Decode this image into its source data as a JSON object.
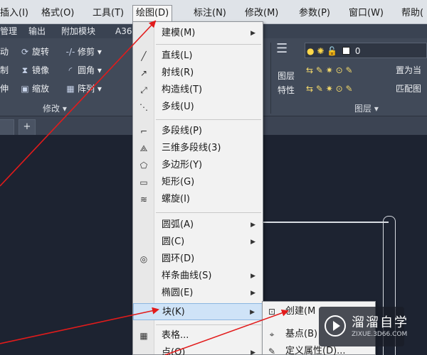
{
  "menubar": {
    "items": [
      "插入(I)",
      "格式(O)",
      "工具(T)",
      "绘图(D)",
      "标注(N)",
      "修改(M)",
      "参数(P)",
      "窗口(W)",
      "帮助("
    ]
  },
  "ribbon_tabs": [
    "管理",
    "输出",
    "附加模块",
    "A36"
  ],
  "ribbon": {
    "modify": {
      "rows": [
        [
          "动",
          "旋转",
          "修剪"
        ],
        [
          "制",
          "镜像",
          "圆角"
        ],
        [
          "伸",
          "缩放",
          "阵列"
        ]
      ],
      "title": "修改 ▾"
    },
    "layers": {
      "big_button_label_1": "图层",
      "big_button_label_2": "特性",
      "current_layer": "0",
      "set_current": "置为当",
      "match": "匹配图",
      "title": "图层 ▾"
    }
  },
  "file_tabs": {
    "add": "+"
  },
  "draw_menu": {
    "items": [
      {
        "label": "建模(M)",
        "sub": true,
        "icon": "none"
      },
      {
        "label": "直线(L)",
        "sub": false,
        "icon": "line-icon"
      },
      {
        "label": "射线(R)",
        "sub": false,
        "icon": "ray-icon"
      },
      {
        "label": "构造线(T)",
        "sub": false,
        "icon": "xline-icon"
      },
      {
        "label": "多线(U)",
        "sub": false,
        "icon": "mline-icon"
      },
      {
        "label": "多段线(P)",
        "sub": false,
        "icon": "polyline-icon"
      },
      {
        "label": "三维多段线(3)",
        "sub": false,
        "icon": "3dpoly-icon"
      },
      {
        "label": "多边形(Y)",
        "sub": false,
        "icon": "polygon-icon"
      },
      {
        "label": "矩形(G)",
        "sub": false,
        "icon": "rectangle-icon"
      },
      {
        "label": "螺旋(I)",
        "sub": false,
        "icon": "helix-icon"
      },
      {
        "label": "圆弧(A)",
        "sub": true,
        "icon": "none"
      },
      {
        "label": "圆(C)",
        "sub": true,
        "icon": "none"
      },
      {
        "label": "圆环(D)",
        "sub": false,
        "icon": "donut-icon"
      },
      {
        "label": "样条曲线(S)",
        "sub": true,
        "icon": "none"
      },
      {
        "label": "椭圆(E)",
        "sub": true,
        "icon": "none"
      },
      {
        "label": "块(K)",
        "sub": true,
        "icon": "none"
      },
      {
        "label": "表格...",
        "sub": false,
        "icon": "table-icon"
      },
      {
        "label": "点(O)",
        "sub": true,
        "icon": "none"
      }
    ]
  },
  "block_submenu": {
    "items": [
      {
        "label": "创建(M",
        "icon": "block-create-icon"
      },
      {
        "label": "基点(B)",
        "icon": "basepoint-icon"
      },
      {
        "label": "定义属性(D)...",
        "icon": "attdef-icon"
      }
    ]
  },
  "watermark": {
    "title": "溜溜自学",
    "url": "ZIXUE.3D66.COM"
  },
  "colors": {
    "arrow": "#e21b1b",
    "highlight": "#cfe3f7"
  }
}
